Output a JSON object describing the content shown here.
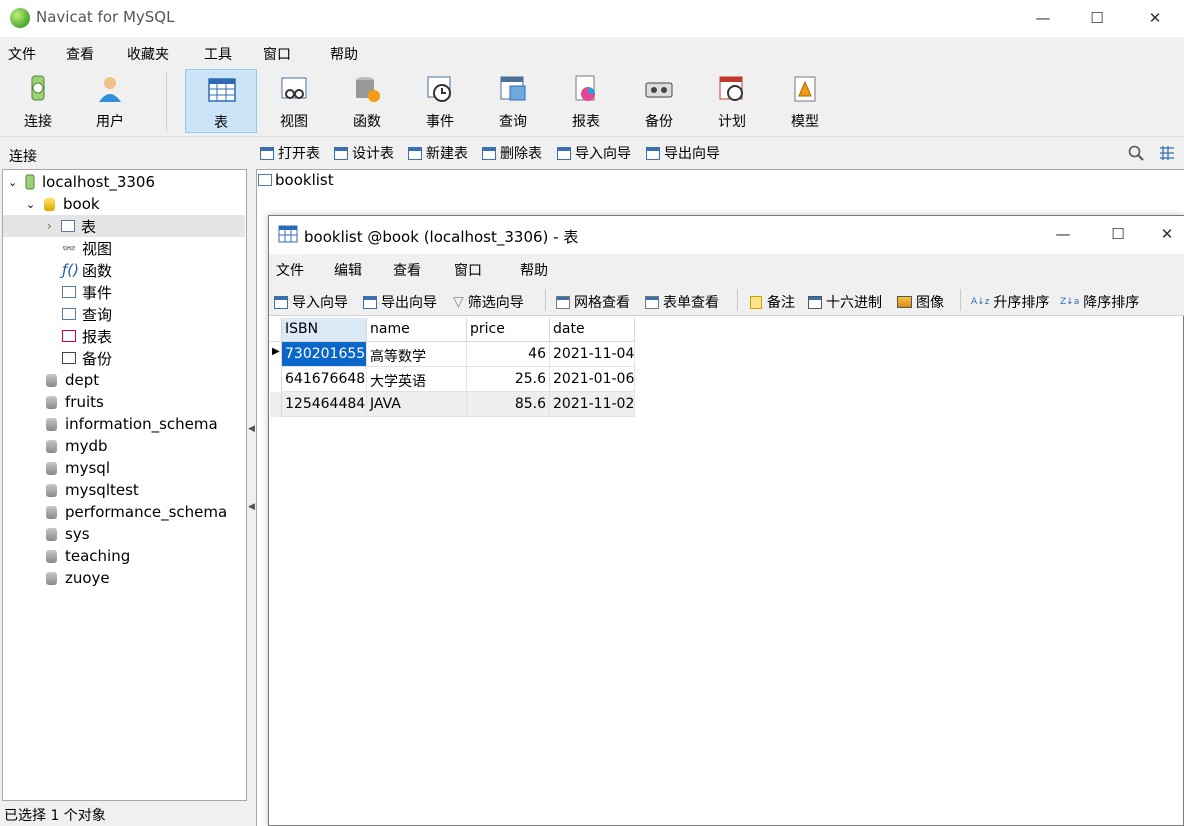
{
  "app": {
    "title": "Navicat for MySQL",
    "minimize": "—",
    "maximize": "☐",
    "close": "✕"
  },
  "menu": [
    "文件",
    "查看",
    "收藏夹",
    "工具",
    "窗口",
    "帮助"
  ],
  "toolbar": [
    {
      "label": "连接",
      "icon": "connection-icon"
    },
    {
      "label": "用户",
      "icon": "user-icon"
    },
    {
      "label": "表",
      "icon": "table-icon",
      "active": true
    },
    {
      "label": "视图",
      "icon": "view-icon"
    },
    {
      "label": "函数",
      "icon": "function-icon"
    },
    {
      "label": "事件",
      "icon": "event-icon"
    },
    {
      "label": "查询",
      "icon": "query-icon"
    },
    {
      "label": "报表",
      "icon": "report-icon"
    },
    {
      "label": "备份",
      "icon": "backup-icon"
    },
    {
      "label": "计划",
      "icon": "schedule-icon"
    },
    {
      "label": "模型",
      "icon": "model-icon"
    }
  ],
  "connection_label": "连接",
  "object_actions": [
    "打开表",
    "设计表",
    "新建表",
    "删除表",
    "导入向导",
    "导出向导"
  ],
  "tree": {
    "connection": "localhost_3306",
    "open_db": "book",
    "open_db_children": [
      "表",
      "视图",
      "函数",
      "事件",
      "查询",
      "报表",
      "备份"
    ],
    "databases": [
      "dept",
      "fruits",
      "information_schema",
      "mydb",
      "mysql",
      "mysqltest",
      "performance_schema",
      "sys",
      "teaching",
      "zuoye"
    ]
  },
  "object_list": [
    "booklist"
  ],
  "status": "已选择 1 个对象",
  "child_window": {
    "title": "booklist @book (localhost_3306) - 表",
    "menu": [
      "文件",
      "编辑",
      "查看",
      "窗口",
      "帮助"
    ],
    "toolbar": [
      "导入向导",
      "导出向导",
      "筛选向导",
      "网格查看",
      "表单查看",
      "备注",
      "十六进制",
      "图像",
      "升序排序",
      "降序排序"
    ]
  },
  "grid": {
    "columns": [
      "ISBN",
      "name",
      "price",
      "date"
    ],
    "rows": [
      [
        "730201655",
        "高等数学",
        "46",
        "2021-11-04"
      ],
      [
        "641676648",
        "大学英语",
        "25.6",
        "2021-01-06"
      ],
      [
        "125464484",
        "JAVA",
        "85.6",
        "2021-11-02"
      ]
    ]
  }
}
